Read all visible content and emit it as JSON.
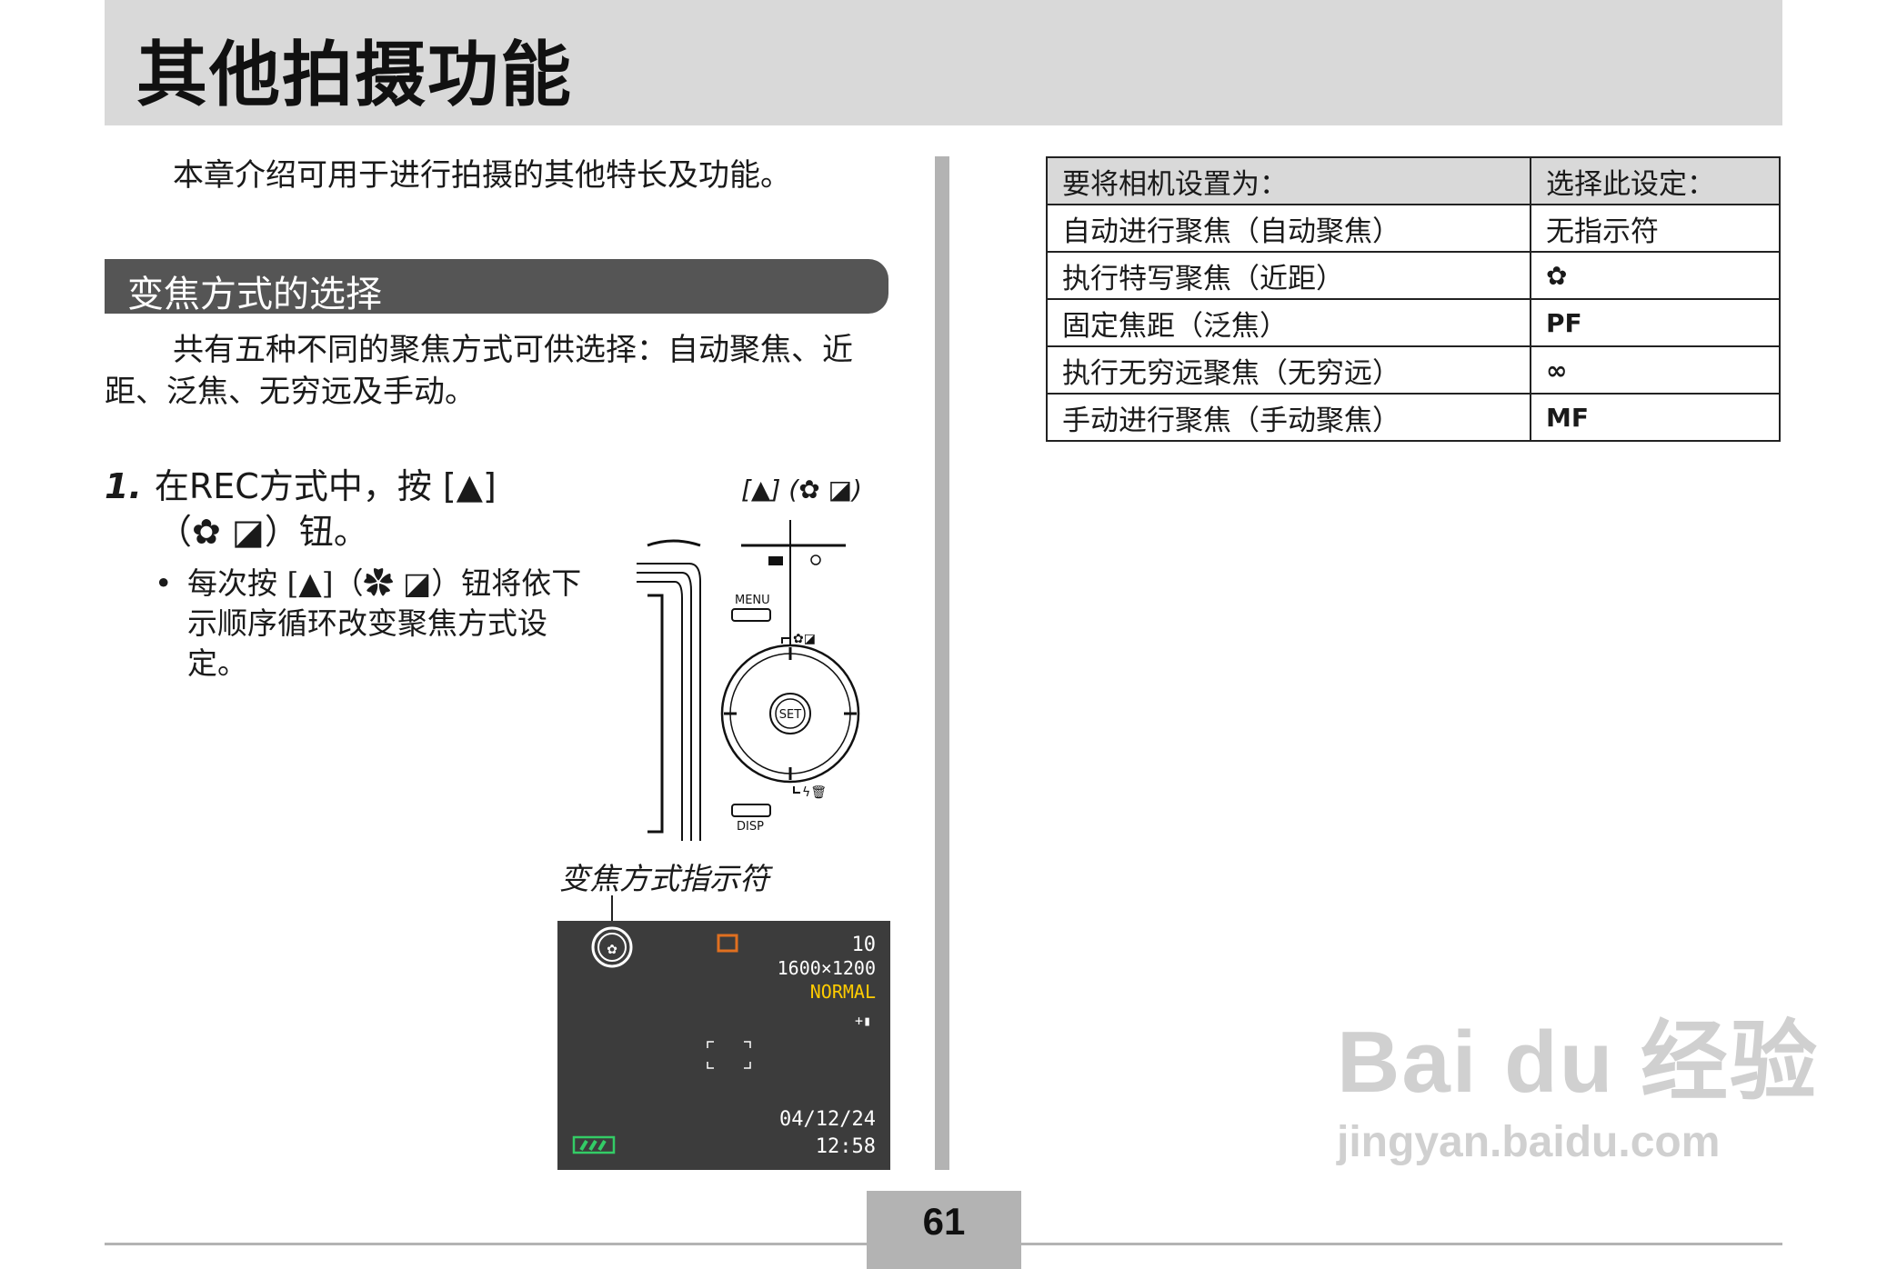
{
  "page_title": "其他拍摄功能",
  "intro": "本章介绍可用于进行拍摄的其他特长及功能。",
  "section_title": "变焦方式的选择",
  "paragraph": "共有五种不同的聚焦方式可供选择：自动聚焦、近距、泛焦、无穷远及手动。",
  "step": {
    "number": "1.",
    "line1": "在REC方式中，按 [▲]",
    "line2": "（✿ ◪）钮。",
    "bullet": "每次按 [▲]（✿ ◪）钮将依下示顺序循环改变聚焦方式设定。"
  },
  "camera": {
    "label": "[▲] (✿ ◪)",
    "menu": "MENU",
    "set": "SET",
    "disp": "DISP"
  },
  "indicator_label": "变焦方式指示符",
  "lcd": {
    "count": "10",
    "size": "1600×1200",
    "quality": "NORMAL",
    "date": "04/12/24",
    "time": "12:58",
    "colors": {
      "quality": "#ffcc00",
      "mode_box": "#e07020",
      "battery": "#33cc66"
    }
  },
  "table": {
    "header": [
      "要将相机设置为：",
      "选择此设定："
    ],
    "rows": [
      [
        "自动进行聚焦（自动聚焦）",
        "无指示符"
      ],
      [
        "执行特写聚焦（近距）",
        "✿"
      ],
      [
        "固定焦距（泛焦）",
        "PF"
      ],
      [
        "执行无穷远聚焦（无穷远）",
        "∞"
      ],
      [
        "手动进行聚焦（手动聚焦）",
        "MF"
      ]
    ]
  },
  "page_number": "61",
  "watermark": {
    "brand": "Bai du 经验",
    "url": "jingyan.baidu.com"
  }
}
